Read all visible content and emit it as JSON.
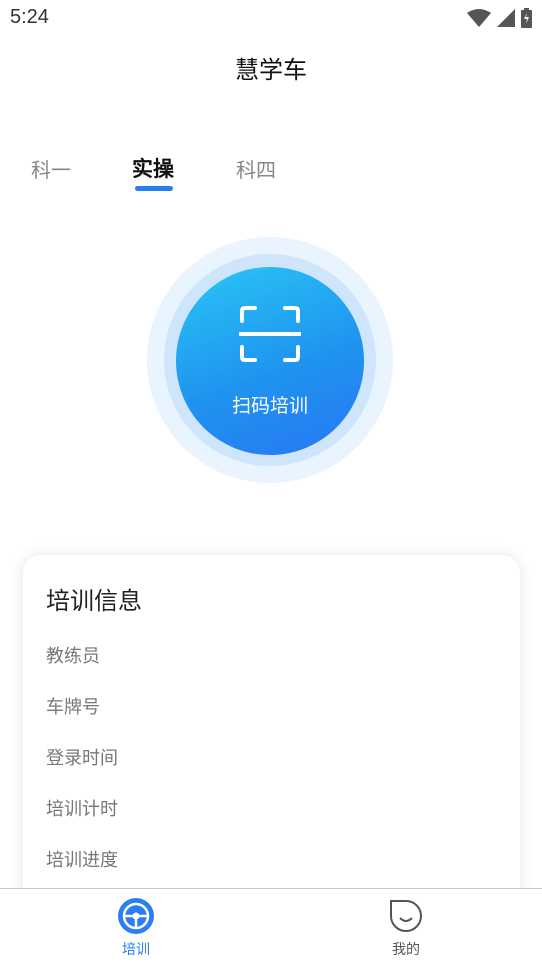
{
  "status_bar": {
    "time": "5:24",
    "icons": [
      "wifi-icon",
      "cell-signal-icon",
      "battery-icon"
    ]
  },
  "app": {
    "title": "慧学车"
  },
  "tabs": [
    {
      "label": "科一",
      "active": false
    },
    {
      "label": "实操",
      "active": true
    },
    {
      "label": "科四",
      "active": false
    }
  ],
  "scan": {
    "label": "扫码培训",
    "icon": "scan-icon"
  },
  "info_card": {
    "title": "培训信息",
    "rows": [
      {
        "label": "教练员"
      },
      {
        "label": "车牌号"
      },
      {
        "label": "登录时间"
      },
      {
        "label": "培训计时"
      },
      {
        "label": "培训进度"
      }
    ]
  },
  "bottom_nav": [
    {
      "label": "培训",
      "icon": "steering-wheel-icon",
      "active": true
    },
    {
      "label": "我的",
      "icon": "smile-face-icon",
      "active": false
    }
  ],
  "colors": {
    "accent": "#2a7ef0",
    "scan_gradient_start": "#2ac6f6",
    "scan_gradient_end": "#2777f3"
  }
}
